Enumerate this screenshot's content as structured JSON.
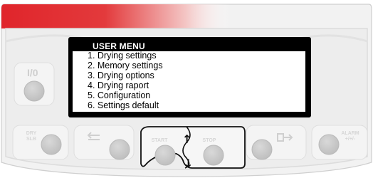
{
  "lcd": {
    "title": "USER MENU",
    "items": [
      "1. Drying settings",
      "2. Memory settings",
      "3. Drying options",
      "4. Drying raport",
      "5. Configuration",
      "6. Settings default"
    ]
  },
  "buttons": {
    "io": {
      "label": "I/0",
      "icon": "power-icon"
    },
    "dry_slb": {
      "label_top": "DRY",
      "label_bottom": "SLB"
    },
    "back": {
      "icon": "back-arrow-icon"
    },
    "start": {
      "label": "START"
    },
    "stop": {
      "label": "STOP"
    },
    "enter": {
      "icon": "enter-arrow-icon"
    },
    "alarm": {
      "label": "ALARM",
      "sub": "+/+/-"
    }
  },
  "colors": {
    "accent_red": "#e0252b",
    "panel_gray": "#e9e9e9",
    "button_gray": "#c9c9c9"
  }
}
